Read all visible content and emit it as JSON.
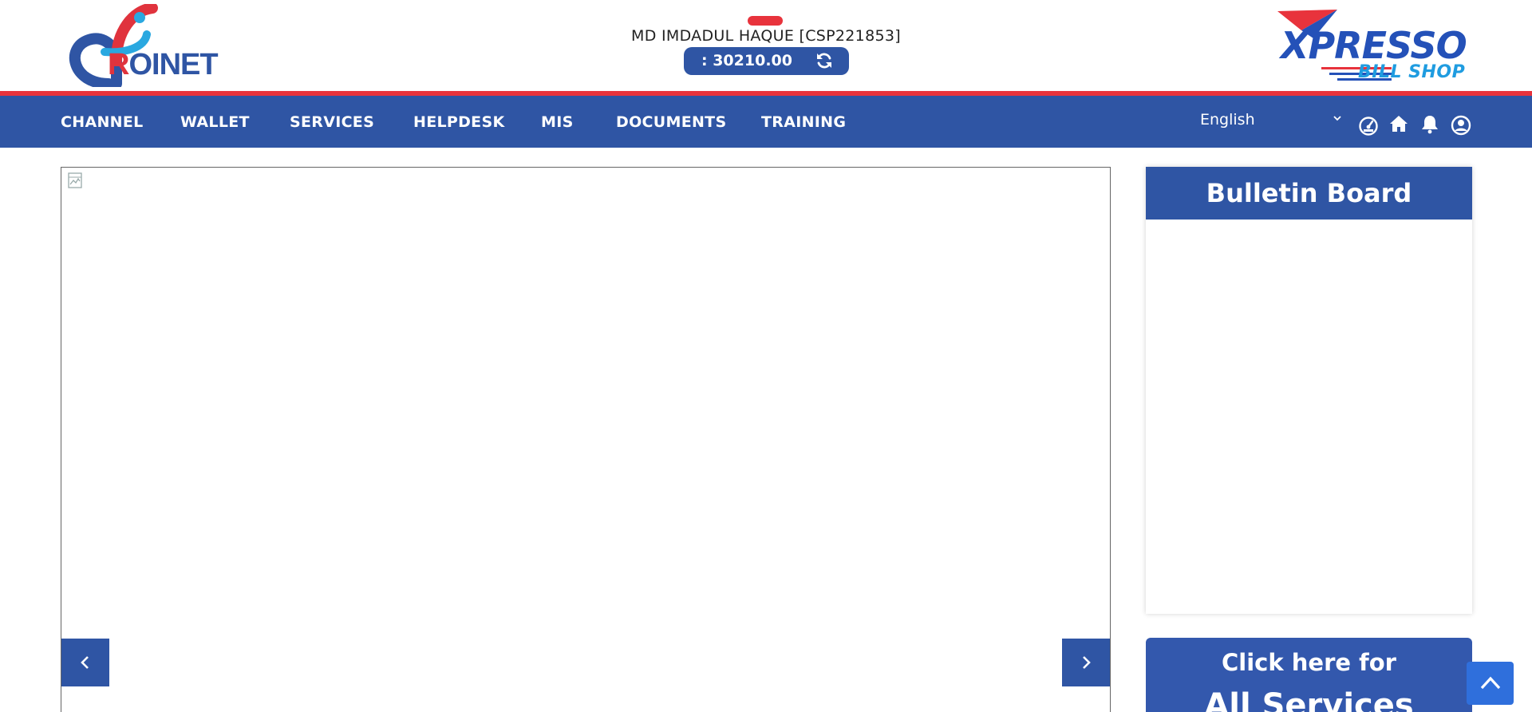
{
  "header": {
    "user_name": "MD IMDADUL HAQUE [CSP221853]",
    "balance": ": 30210.00",
    "logo_left": {
      "first_letter": "R",
      "rest": "OINET"
    },
    "logo_right": {
      "main": "XPRESSO",
      "sub": "BILL SHOP"
    }
  },
  "nav": {
    "items": [
      "CHANNEL",
      "WALLET",
      "SERVICES",
      "HELPDESK",
      "MIS",
      "DOCUMENTS",
      "TRAINING"
    ],
    "language": "English"
  },
  "sidebar": {
    "bulletin_title": "Bulletin Board",
    "services_line1": "Click here for",
    "services_line2": "All Services"
  },
  "colors": {
    "primary": "#2f55a4",
    "accent_red": "#e8333c",
    "scroll_button": "#2f6fdc"
  },
  "icons": {
    "refresh": "refresh-icon",
    "speedometer": "speedometer-icon",
    "home": "home-icon",
    "bell": "bell-icon",
    "user": "user-circle-icon",
    "chevron_left": "chevron-left-icon",
    "chevron_right": "chevron-right-icon",
    "chevron_up": "chevron-up-icon"
  }
}
